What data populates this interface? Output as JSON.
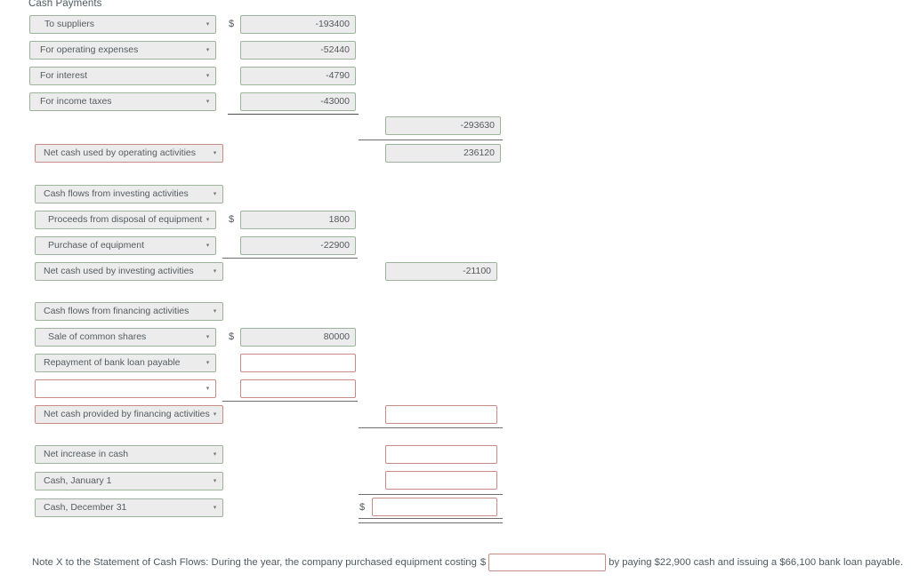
{
  "form": {
    "caption": "Cash Payments",
    "note": {
      "before": "Note X to the Statement of Cash Flows: During the year, the company purchased equipment costing",
      "dollar": "$",
      "input_value": "",
      "after": "by paying $22,900 cash and issuing a $66,100 bank loan payable."
    },
    "colors": {
      "valid_border": "#9cb59a",
      "invalid_border": "#c98b85",
      "filled_background": "#ececec",
      "empty_background": "#ffffff",
      "text": "#55595c",
      "caption_text": "#4e5a60",
      "rule": "#4f4f4f"
    },
    "caret_glyph": "▾",
    "rows": [
      {
        "id": "to-suppliers",
        "label": "To suppliers",
        "label_state": "valid",
        "indent": 2,
        "dollar": "$",
        "col1": {
          "value": "-193400",
          "state": "valid"
        },
        "col2": null
      },
      {
        "id": "for-operating-expenses",
        "label": "For operating expenses",
        "label_state": "valid",
        "indent": 1,
        "dollar": "",
        "col1": {
          "value": "-52440",
          "state": "valid"
        },
        "col2": null
      },
      {
        "id": "for-interest",
        "label": "For interest",
        "label_state": "valid",
        "indent": 1,
        "dollar": "",
        "col1": {
          "value": "-4790",
          "state": "valid"
        },
        "col2": null
      },
      {
        "id": "for-income-taxes",
        "label": "For income taxes",
        "label_state": "valid",
        "indent": 1,
        "dollar": "",
        "col1": {
          "value": "-43000",
          "state": "valid"
        },
        "col2": null
      },
      {
        "id": "total-cash-payments",
        "label": null,
        "label_state": null,
        "indent": 0,
        "dollar": "",
        "col1": null,
        "col2": {
          "value": "-293630",
          "state": "valid"
        }
      },
      {
        "id": "net-cash-used-by-operating-activities",
        "label": "Net cash used by operating activities",
        "label_state": "invalid",
        "indent": 0,
        "dollar": "",
        "col1": null,
        "col2": {
          "value": "236120",
          "state": "valid"
        }
      },
      {
        "id": "cash-flows-from-investing-activities",
        "label": "Cash flows from investing activities",
        "label_state": "valid",
        "indent": 0,
        "dollar": "",
        "col1": null,
        "col2": null
      },
      {
        "id": "proceeds-from-disposal-of-equipment",
        "label": "Proceeds from disposal of equipment",
        "label_state": "valid",
        "indent": 1,
        "dollar": "$",
        "col1": {
          "value": "1800",
          "state": "valid"
        },
        "col2": null
      },
      {
        "id": "purchase-of-equipment",
        "label": "Purchase of equipment",
        "label_state": "valid",
        "indent": 1,
        "dollar": "",
        "col1": {
          "value": "-22900",
          "state": "valid"
        },
        "col2": null
      },
      {
        "id": "net-cash-used-by-investing-activities",
        "label": "Net cash used by investing activities",
        "label_state": "valid",
        "indent": 0,
        "dollar": "",
        "col1": null,
        "col2": {
          "value": "-21100",
          "state": "valid"
        }
      },
      {
        "id": "cash-flows-from-financing-activities",
        "label": "Cash flows from financing activities",
        "label_state": "valid",
        "indent": 0,
        "dollar": "",
        "col1": null,
        "col2": null
      },
      {
        "id": "sale-of-common-shares",
        "label": "Sale of common shares",
        "label_state": "valid",
        "indent": 1,
        "dollar": "$",
        "col1": {
          "value": "80000",
          "state": "valid"
        },
        "col2": null
      },
      {
        "id": "repayment-of-bank-loan-payable",
        "label": "Repayment of bank loan payable",
        "label_state": "valid",
        "indent": 0,
        "dollar": "",
        "col1": {
          "value": "",
          "state": "invalid"
        },
        "col2": null
      },
      {
        "id": "blank-financing-row",
        "label": "",
        "label_state": "invalid",
        "indent": 0,
        "dollar": "",
        "col1": {
          "value": "",
          "state": "invalid"
        },
        "col2": null
      },
      {
        "id": "net-cash-provided-by-financing-activities",
        "label": "Net cash provided by financing activities",
        "label_state": "invalid",
        "indent": 0,
        "dollar": "",
        "col1": null,
        "col2": {
          "value": "",
          "state": "invalid"
        }
      },
      {
        "id": "net-increase-in-cash",
        "label": "Net increase in cash",
        "label_state": "valid",
        "indent": 0,
        "dollar": "",
        "col1": null,
        "col2": {
          "value": "",
          "state": "invalid"
        }
      },
      {
        "id": "cash-january-1",
        "label": "Cash, January 1",
        "label_state": "valid",
        "indent": 0,
        "dollar": "",
        "col1": null,
        "col2": {
          "value": "",
          "state": "invalid"
        }
      },
      {
        "id": "cash-december-31",
        "label": "Cash, December 31",
        "label_state": "valid",
        "indent": 0,
        "dollar": "$",
        "col1": null,
        "col2": {
          "value": "",
          "state": "invalid"
        }
      }
    ]
  }
}
